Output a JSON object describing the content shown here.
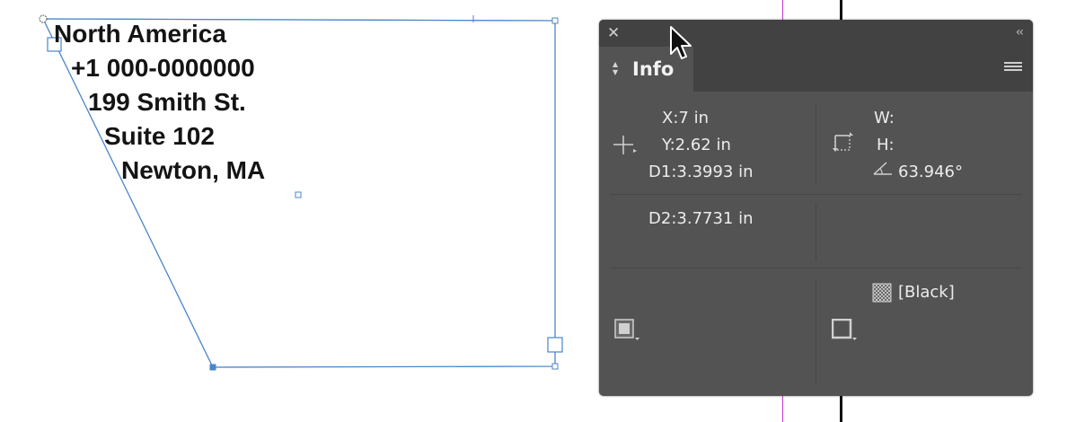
{
  "canvas": {
    "address_lines": [
      "North America",
      "+1 000-0000000",
      "199 Smith St.",
      "Suite 102",
      "Newton, MA"
    ],
    "colors": {
      "frame": "#4a86c8",
      "guide_magenta": "#c23bd0"
    }
  },
  "panel": {
    "tab_label": "Info",
    "close_glyph": "✕",
    "collapse_glyph": "‹‹",
    "position": {
      "x_label": "X:",
      "x_value": "7 in",
      "y_label": "Y:",
      "y_value": "2.62 in",
      "d1_label": "D1:",
      "d1_value": "3.3993 in"
    },
    "size": {
      "w_label": "W:",
      "w_value": "",
      "h_label": "H:",
      "h_value": "",
      "angle_value": "63.946°"
    },
    "d2": {
      "label": "D2:",
      "value": "3.7731 in"
    },
    "stroke_swatch_name": "[Black]"
  }
}
